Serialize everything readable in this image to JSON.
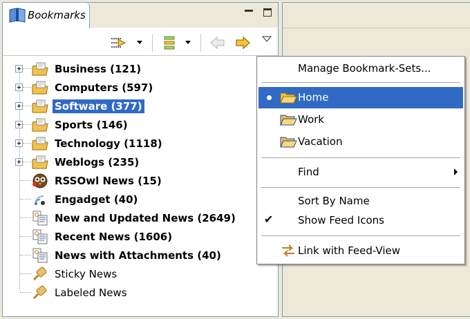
{
  "view": {
    "tab_label": "Bookmarks"
  },
  "tree": {
    "items": [
      {
        "label": "Business (121)",
        "type": "folder",
        "expandable": true
      },
      {
        "label": "Computers (597)",
        "type": "folder",
        "expandable": true
      },
      {
        "label": "Software (377)",
        "type": "folder",
        "expandable": true,
        "selected": true
      },
      {
        "label": "Sports (146)",
        "type": "folder",
        "expandable": true
      },
      {
        "label": "Technology (1118)",
        "type": "folder",
        "expandable": true
      },
      {
        "label": "Weblogs (235)",
        "type": "folder",
        "expandable": true
      },
      {
        "label": "RSSOwl News (15)",
        "type": "feed-owl"
      },
      {
        "label": "Engadget (40)",
        "type": "feed"
      },
      {
        "label": "New and Updated News (2649)",
        "type": "search"
      },
      {
        "label": "Recent News (1606)",
        "type": "search"
      },
      {
        "label": "News with Attachments (40)",
        "type": "search"
      },
      {
        "label": "Sticky News",
        "type": "bin",
        "plain": true
      },
      {
        "label": "Labeled News",
        "type": "bin",
        "plain": true
      }
    ]
  },
  "menu": {
    "manage": "Manage Bookmark-Sets...",
    "sets": [
      {
        "label": "Home",
        "selected": true
      },
      {
        "label": "Work"
      },
      {
        "label": "Vacation"
      }
    ],
    "find": "Find",
    "sort_by_name": "Sort By Name",
    "show_feed_icons": "Show Feed Icons",
    "link_with_feed_view": "Link with Feed-View"
  },
  "colors": {
    "selection": "#316ac5",
    "border": "#7f9db9",
    "folder": "#f0c050"
  },
  "icons": {
    "tab": "bookmarks-book-icon",
    "toolbar": [
      "filter-icon",
      "layout-icon",
      "back-arrow-icon",
      "forward-arrow-icon",
      "view-menu-icon"
    ]
  }
}
